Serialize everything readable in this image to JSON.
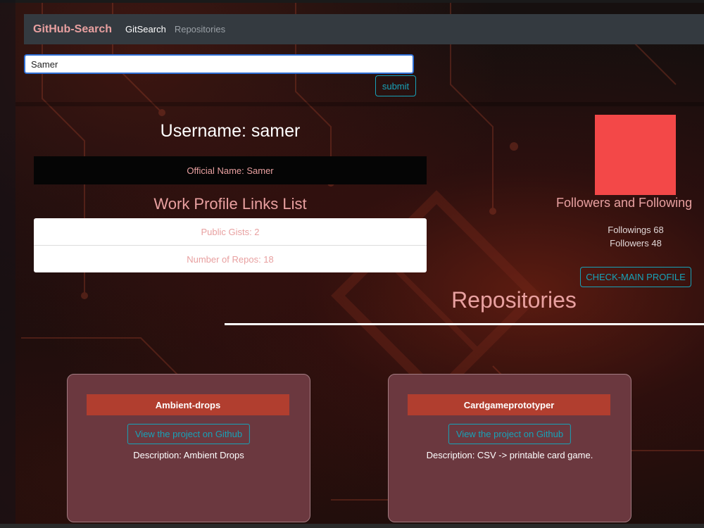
{
  "navbar": {
    "brand": "GitHub-Search",
    "links": [
      {
        "label": "GitSearch",
        "active": true
      },
      {
        "label": "Repositories",
        "active": false
      }
    ]
  },
  "search": {
    "value": "Samer",
    "submit_label": "submit"
  },
  "profile": {
    "username_heading": "Username: samer",
    "official_name": "Official Name: Samer",
    "work_links_title": "Work Profile Links List",
    "work_links": [
      {
        "label": "Public Gists: 2"
      },
      {
        "label": "Number of Repos: 18"
      }
    ],
    "avatar_color": "#f34848",
    "followers_title": "Followers and Following",
    "followings": "Followings 68",
    "followers": "Followers 48",
    "check_profile_label": "CHECK-MAIN PROFILE"
  },
  "repositories": {
    "title": "Repositories",
    "cards": [
      {
        "name": "Ambient-drops",
        "link_label": "View the project on Github",
        "description": "Description: Ambient Drops"
      },
      {
        "name": "Cardgameprototyper",
        "link_label": "View the project on Github",
        "description": "Description: CSV -> printable card game."
      }
    ]
  },
  "colors": {
    "accent": "#17a2b8",
    "title_pink": "#e8a0a0",
    "card_bg": "#6b383f",
    "card_header": "#b13e2f",
    "navbar_bg": "#343a40"
  }
}
